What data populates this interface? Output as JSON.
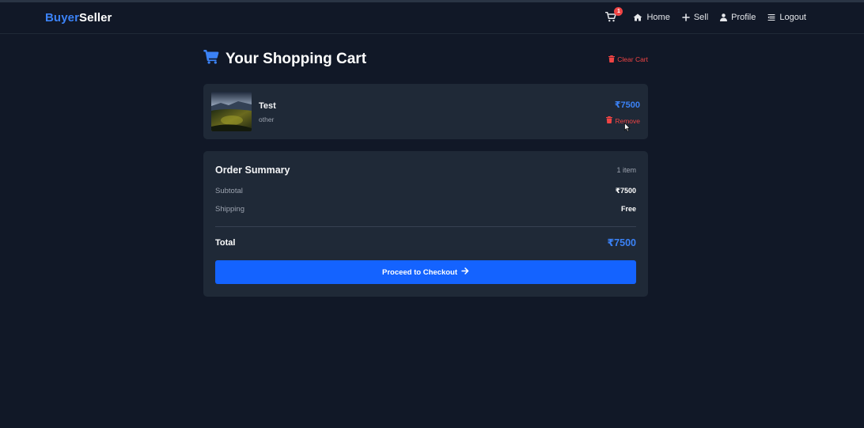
{
  "nav": {
    "brand_part1": "Buyer",
    "brand_part2": "Seller",
    "cart_count": "1",
    "home_label": "Home",
    "sell_label": "Sell",
    "profile_label": "Profile",
    "logout_label": "Logout"
  },
  "cart": {
    "title": "Your Shopping Cart",
    "clear_label": "Clear Cart",
    "items": [
      {
        "name": "Test",
        "category": "other",
        "price": "₹7500",
        "remove_label": "Remove"
      }
    ]
  },
  "summary": {
    "title": "Order Summary",
    "item_count": "1 item",
    "subtotal_label": "Subtotal",
    "subtotal_value": "₹7500",
    "shipping_label": "Shipping",
    "shipping_value": "Free",
    "total_label": "Total",
    "total_value": "₹7500",
    "checkout_label": "Proceed to Checkout"
  },
  "colors": {
    "background": "#111827",
    "card": "#1f2937",
    "accent": "#3b82f6",
    "button": "#1463ff",
    "danger": "#ef4444"
  },
  "icons": [
    "cart-icon",
    "home-icon",
    "plus-icon",
    "user-icon",
    "logout-icon",
    "trash-icon",
    "arrow-right-icon"
  ]
}
